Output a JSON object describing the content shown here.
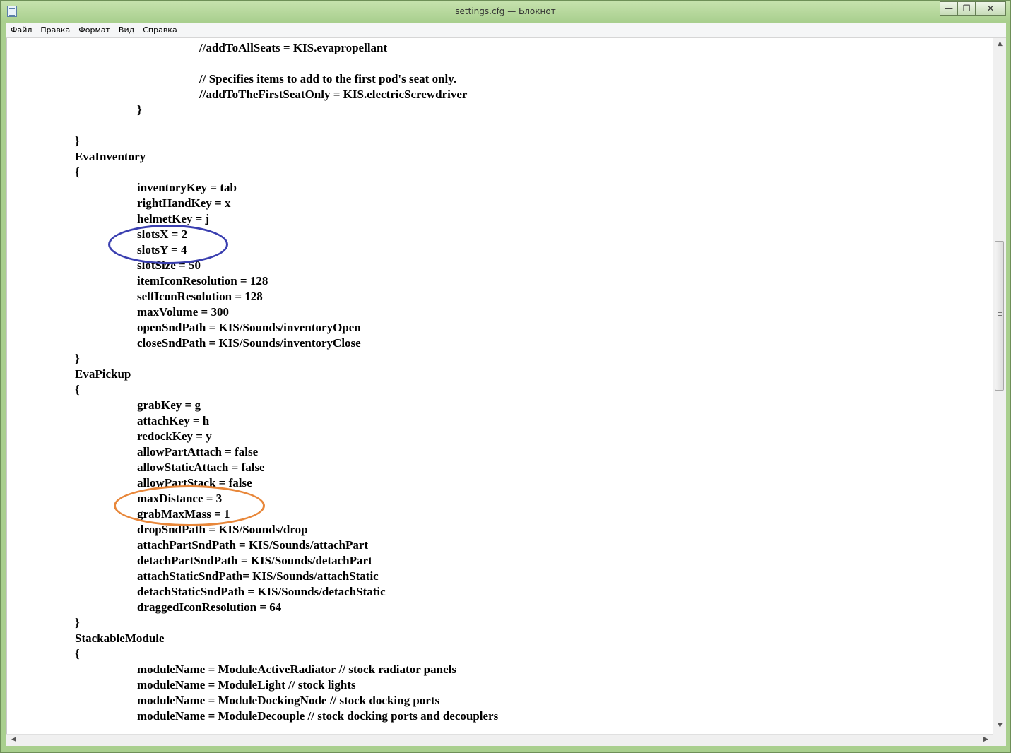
{
  "window": {
    "title": "settings.cfg — Блокнот",
    "controls": {
      "minimize": "minimize-icon",
      "maximize": "maximize-icon",
      "close": "close-icon"
    }
  },
  "menu": [
    "Файл",
    "Правка",
    "Формат",
    "Вид",
    "Справка"
  ],
  "editor": {
    "lines": [
      {
        "indent": 2,
        "text": "//addToAllSeats = KIS.evapropellant"
      },
      {
        "indent": 0,
        "text": ""
      },
      {
        "indent": 2,
        "text": "// Specifies items to add to the first pod's seat only."
      },
      {
        "indent": 2,
        "text": "//addToTheFirstSeatOnly = KIS.electricScrewdriver"
      },
      {
        "indent": 1,
        "text": "}"
      },
      {
        "indent": 0,
        "text": ""
      },
      {
        "indent": 0,
        "text": "}"
      },
      {
        "indent": 0,
        "text": "EvaInventory"
      },
      {
        "indent": 0,
        "text": "{"
      },
      {
        "indent": 1,
        "text": "inventoryKey = tab"
      },
      {
        "indent": 1,
        "text": "rightHandKey = x"
      },
      {
        "indent": 1,
        "text": "helmetKey = j"
      },
      {
        "indent": 1,
        "text": "slotsX = 2"
      },
      {
        "indent": 1,
        "text": "slotsY = 4"
      },
      {
        "indent": 1,
        "text": "slotSize = 50"
      },
      {
        "indent": 1,
        "text": "itemIconResolution = 128"
      },
      {
        "indent": 1,
        "text": "selfIconResolution = 128"
      },
      {
        "indent": 1,
        "text": "maxVolume = 300"
      },
      {
        "indent": 1,
        "text": "openSndPath = KIS/Sounds/inventoryOpen"
      },
      {
        "indent": 1,
        "text": "closeSndPath = KIS/Sounds/inventoryClose"
      },
      {
        "indent": 0,
        "text": "}"
      },
      {
        "indent": 0,
        "text": "EvaPickup"
      },
      {
        "indent": 0,
        "text": "{"
      },
      {
        "indent": 1,
        "text": "grabKey = g"
      },
      {
        "indent": 1,
        "text": "attachKey = h"
      },
      {
        "indent": 1,
        "text": "redockKey = y"
      },
      {
        "indent": 1,
        "text": "allowPartAttach = false"
      },
      {
        "indent": 1,
        "text": "allowStaticAttach = false"
      },
      {
        "indent": 1,
        "text": "allowPartStack = false"
      },
      {
        "indent": 1,
        "text": "maxDistance = 3"
      },
      {
        "indent": 1,
        "text": "grabMaxMass = 1"
      },
      {
        "indent": 1,
        "text": "dropSndPath = KIS/Sounds/drop"
      },
      {
        "indent": 1,
        "text": "attachPartSndPath = KIS/Sounds/attachPart"
      },
      {
        "indent": 1,
        "text": "detachPartSndPath = KIS/Sounds/detachPart"
      },
      {
        "indent": 1,
        "text": "attachStaticSndPath= KIS/Sounds/attachStatic"
      },
      {
        "indent": 1,
        "text": "detachStaticSndPath = KIS/Sounds/detachStatic"
      },
      {
        "indent": 1,
        "text": "draggedIconResolution = 64"
      },
      {
        "indent": 0,
        "text": "}"
      },
      {
        "indent": 0,
        "text": "StackableModule"
      },
      {
        "indent": 0,
        "text": "{"
      },
      {
        "indent": 1,
        "text": "moduleName = ModuleActiveRadiator // stock radiator panels"
      },
      {
        "indent": 1,
        "text": "moduleName = ModuleLight // stock lights"
      },
      {
        "indent": 1,
        "text": "moduleName = ModuleDockingNode // stock docking ports"
      },
      {
        "indent": 1,
        "text": "moduleName = ModuleDecouple // stock docking ports and decouplers"
      }
    ]
  },
  "annotations": {
    "blue_color": "#3a3fb0",
    "orange_color": "#e8873a"
  }
}
